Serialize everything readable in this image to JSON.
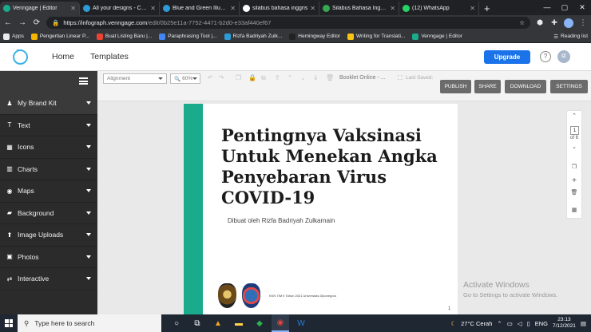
{
  "browser": {
    "tabs": [
      {
        "label": "Venngage | Editor",
        "favicon": "#1aab8c",
        "active": true
      },
      {
        "label": "All your designs - Canva",
        "favicon": "#2c9bd6",
        "active": false
      },
      {
        "label": "Blue and Green Illustrated",
        "favicon": "#2c9bd6",
        "active": false
      },
      {
        "label": "silabus bahasa inggris",
        "favicon": "#ffffff",
        "active": false
      },
      {
        "label": "Silabus Bahasa Inggris",
        "favicon": "#34a853",
        "active": false
      },
      {
        "label": "(12) WhatsApp",
        "favicon": "#25d366",
        "active": false
      }
    ],
    "new_tab": "+",
    "address": {
      "host": "https://infograph.venngage.com",
      "path": "/edit/0b25e11a-7752-4471-b2d0-e33af440ef67"
    },
    "bookmarks": [
      {
        "label": "Apps",
        "color": "#e8eaed"
      },
      {
        "label": "Pengertian Linear P...",
        "color": "#f4b400"
      },
      {
        "label": "Buat Listing Baru |...",
        "color": "#ea4335"
      },
      {
        "label": "Paraphrasing Tool |...",
        "color": "#4285f4"
      },
      {
        "label": "Rizfa Badriyah Zulk...",
        "color": "#2c9bd6"
      },
      {
        "label": "Hemingway Editor",
        "color": "#222222"
      },
      {
        "label": "Writing for Translati...",
        "color": "#f9c513"
      },
      {
        "label": "Venngage | Editor",
        "color": "#1aab8c"
      }
    ],
    "reading_list": "Reading list"
  },
  "header": {
    "nav": [
      "Home",
      "Templates"
    ],
    "upgrade": "Upgrade",
    "help": "?",
    "avatar": "IZ"
  },
  "sidebar": {
    "items": [
      {
        "label": "My Brand Kit",
        "icon": "person-icon",
        "glyph": "♟"
      },
      {
        "label": "Text",
        "icon": "text-icon",
        "glyph": "T"
      },
      {
        "label": "Icons",
        "icon": "icons-grid-icon",
        "glyph": "▦"
      },
      {
        "label": "Charts",
        "icon": "chart-icon",
        "glyph": "▥"
      },
      {
        "label": "Maps",
        "icon": "globe-icon",
        "glyph": "◉"
      },
      {
        "label": "Background",
        "icon": "background-icon",
        "glyph": "▰"
      },
      {
        "label": "Image Uploads",
        "icon": "upload-icon",
        "glyph": "⬆"
      },
      {
        "label": "Photos",
        "icon": "photo-icon",
        "glyph": "▣"
      },
      {
        "label": "Interactive",
        "icon": "interactive-icon",
        "glyph": "⇄"
      }
    ]
  },
  "toolbar": {
    "alignment": "Alignment",
    "zoom": "60%",
    "doc_name": "Booklet Online - ...",
    "last_saved": "Last Saved:",
    "buttons": [
      "PUBLISH",
      "SHARE",
      "DOWNLOAD",
      "SETTINGS"
    ]
  },
  "document": {
    "title": "Pentingnya Vaksinasi Untuk Menekan Angka Penyebaran Virus COVID-19",
    "subtitle": "Dibuat oleh Rizfa Badriyah Zulkarnain",
    "footer": "KKN TIM II Tahun 2021 Universitas Diponegoro",
    "page_number": "1"
  },
  "pager": {
    "current": "1",
    "of": "of 6"
  },
  "watermark": {
    "line1": "Activate Windows",
    "line2": "Go to Settings to activate Windows."
  },
  "taskbar": {
    "search": "Type here to search",
    "weather": "27°C  Cerah",
    "lang": "ENG",
    "time": "23:13",
    "date": "7/12/2021"
  }
}
